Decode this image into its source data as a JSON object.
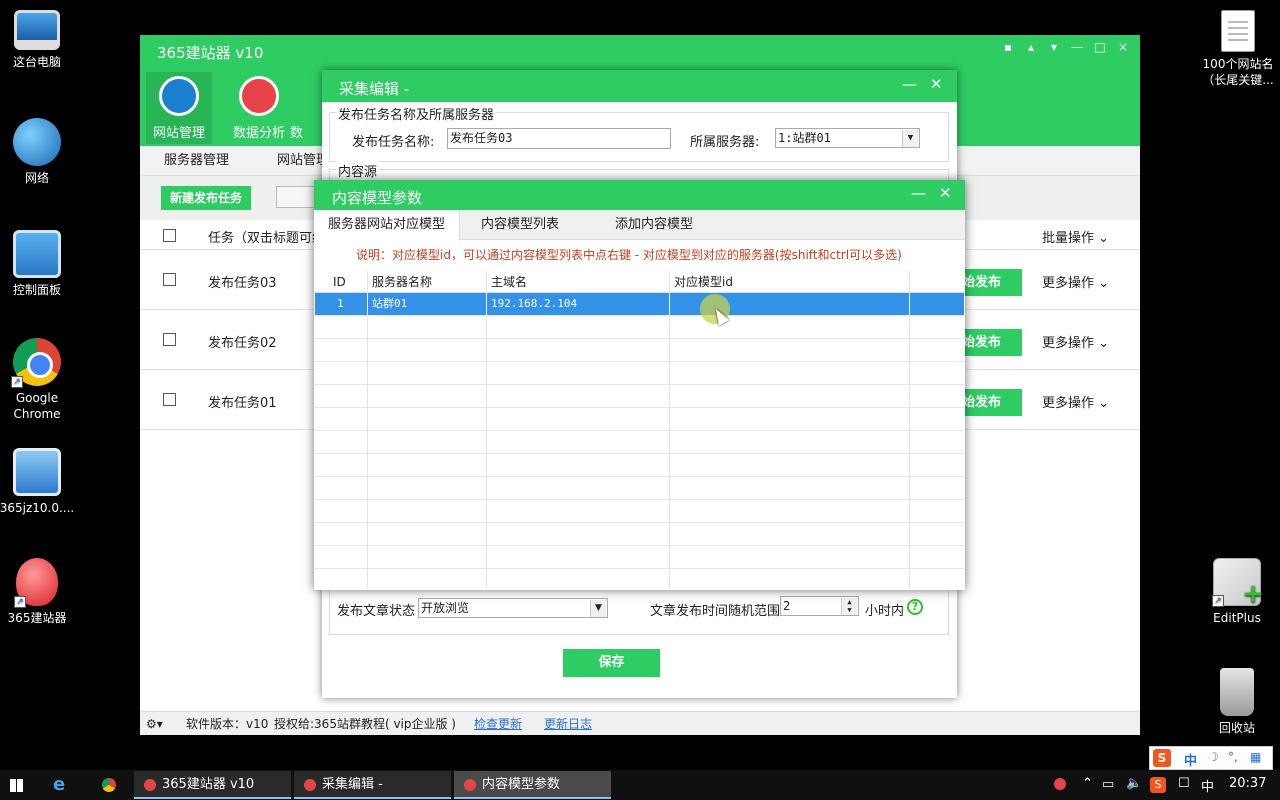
{
  "desktop": {
    "icons_left": [
      "这台电脑",
      "网络",
      "控制面板",
      "Google Chrome",
      "365jz10.0....",
      "365建站器"
    ],
    "icons_right": [
      "100个网站名（长尾关键...",
      "EditPlus",
      "回收站"
    ]
  },
  "main_window": {
    "title": "365建站器 v10",
    "controls": [
      "▪",
      "▴",
      "▾",
      "—",
      "□",
      "×"
    ],
    "nav": [
      "网站管理",
      "数据分析",
      "数"
    ],
    "subtabs": [
      "服务器管理",
      "网站管理"
    ],
    "new_task_button": "新建发布任务",
    "list_header": {
      "task_col": "任务（双击标题可编",
      "batch_op": "批量操作"
    },
    "rows": [
      {
        "title": "发布任务03",
        "publish": "始发布",
        "more": "更多操作"
      },
      {
        "title": "发布任务02",
        "publish": "始发布",
        "more": "更多操作"
      },
      {
        "title": "发布任务01",
        "publish": "始发布",
        "more": "更多操作"
      }
    ],
    "status": {
      "version": "软件版本：v10",
      "license": "授权给:365站群教程( vip企业版 )",
      "check_update": "检查更新",
      "changelog": "更新日志"
    }
  },
  "collect_dialog": {
    "title": "采集编辑 -",
    "section_publish": "发布任务名称及所属服务器",
    "task_name_label": "发布任务名称:",
    "task_name_value": "发布任务03",
    "server_label": "所属服务器:",
    "server_value": "1:站群01",
    "section_source": "内容源",
    "article_status_label": "发布文章状态",
    "article_status_value": "开放浏览",
    "time_range_label": "文章发布时间随机范围",
    "time_range_value": "2",
    "time_unit": "小时内",
    "save": "保存"
  },
  "model_dialog": {
    "title": "内容模型参数",
    "tabs": [
      "服务器网站对应模型",
      "内容模型列表",
      "添加内容模型"
    ],
    "note": "说明：对应模型id，可以通过内容模型列表中点右键 - 对应模型到对应的服务器(按shift和ctrl可以多选)",
    "columns": [
      "ID",
      "服务器名称",
      "主域名",
      "对应模型id"
    ],
    "rows": [
      {
        "id": "1",
        "server": "站群01",
        "domain": "192.168.2.104",
        "model_id": ""
      }
    ]
  },
  "taskbar": {
    "tasks": [
      "365建站器 v10",
      "采集编辑 -",
      "内容模型参数"
    ],
    "ime": "中",
    "clock": "20:37"
  }
}
